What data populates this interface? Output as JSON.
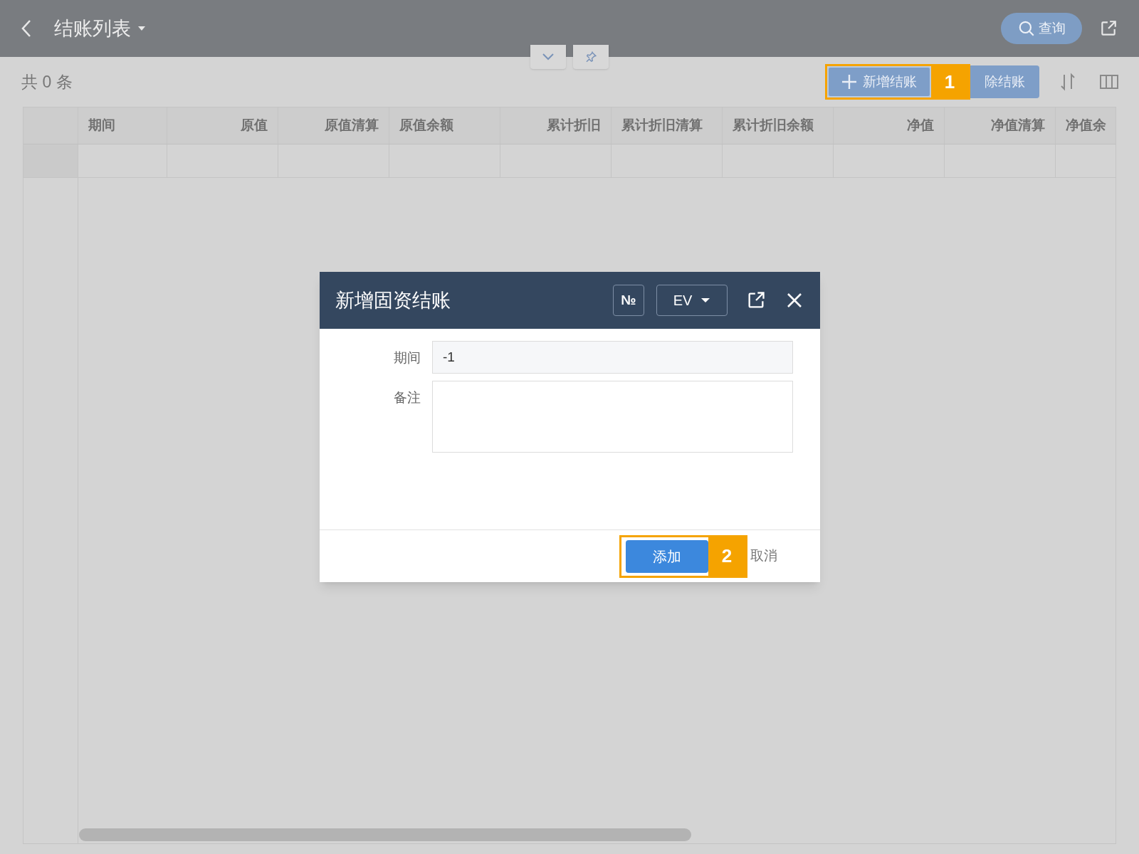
{
  "header": {
    "title": "结账列表",
    "search_button": "查询"
  },
  "toolbar": {
    "count": "共 0 条",
    "buttons": [
      {
        "label": "新增结账",
        "kind": "add",
        "callout": "1"
      },
      {
        "label": "除结账",
        "kind": "plain"
      }
    ]
  },
  "table": {
    "columns": [
      {
        "label": "期间"
      },
      {
        "label": "原值"
      },
      {
        "label": "原值清算"
      },
      {
        "label": "原值余额"
      },
      {
        "label": "累计折旧"
      },
      {
        "label": "累计折旧清算"
      },
      {
        "label": "累计折旧余额"
      },
      {
        "label": "净值"
      },
      {
        "label": "净值清算"
      },
      {
        "label": "净值余"
      }
    ]
  },
  "dialog": {
    "title": "新增固资结账",
    "numbering_button": "№",
    "language": "EV",
    "fields": [
      {
        "label": "期间",
        "kind": "input",
        "value": "-1"
      },
      {
        "label": "备注",
        "kind": "textarea"
      }
    ],
    "buttons": [
      {
        "label": "添加",
        "kind": "primary",
        "callout": "2"
      },
      {
        "label": "取消",
        "kind": "link"
      }
    ]
  }
}
